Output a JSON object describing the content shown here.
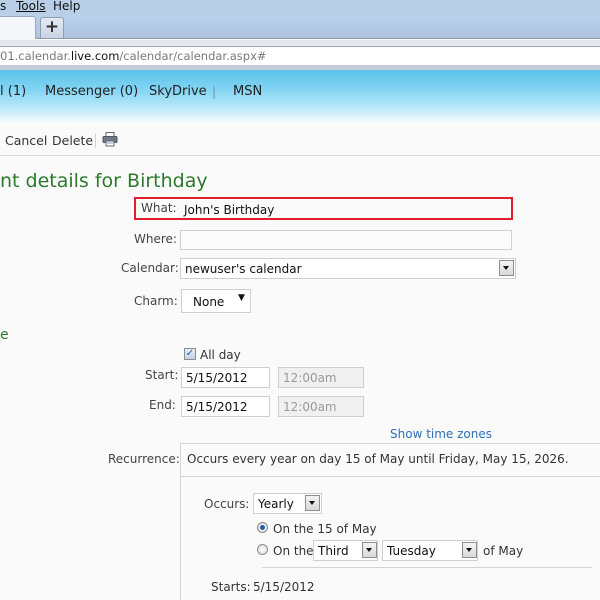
{
  "browser": {
    "menu": [
      "s",
      "Tools",
      "Help"
    ],
    "new_tab_label": "+",
    "url": {
      "prefix": "01.calendar.",
      "domain": "live.com",
      "path": "/calendar/calendar.aspx#"
    }
  },
  "header": {
    "nav_items": [
      "l (1)",
      "Messenger (0)",
      "SkyDrive",
      "MSN"
    ],
    "separator": "|"
  },
  "toolbar": {
    "cancel_label": "Cancel",
    "delete_label": "Delete",
    "print_icon": "printer-icon"
  },
  "page": {
    "title": "nt details for Birthday",
    "section_when_fragment": "e"
  },
  "form": {
    "what_label": "What:",
    "what_value": "John's Birthday",
    "where_label": "Where:",
    "where_value": "",
    "calendar_label": "Calendar:",
    "calendar_value": "newuser's calendar",
    "charm_label": "Charm:",
    "charm_value": "None",
    "all_day_label": "All day",
    "all_day_checked": true,
    "start_label": "Start:",
    "start_date": "5/15/2012",
    "start_time": "12:00am",
    "end_label": "End:",
    "end_date": "5/15/2012",
    "end_time": "12:00am",
    "show_time_zones": "Show time zones",
    "recurrence_label": "Recurrence:",
    "recurrence_summary": "Occurs every year on day 15 of May until Friday, May 15, 2026."
  },
  "recurrence": {
    "occurs_label": "Occurs:",
    "occurs_value": "Yearly",
    "option1_label": "On the 15 of May",
    "option1_selected": true,
    "option2_prefix": "On the",
    "option2_ordinal": "Third",
    "option2_weekday": "Tuesday",
    "option2_suffix": "of May",
    "option2_selected": false,
    "starts_label": "Starts:",
    "starts_value": "5/15/2012"
  }
}
